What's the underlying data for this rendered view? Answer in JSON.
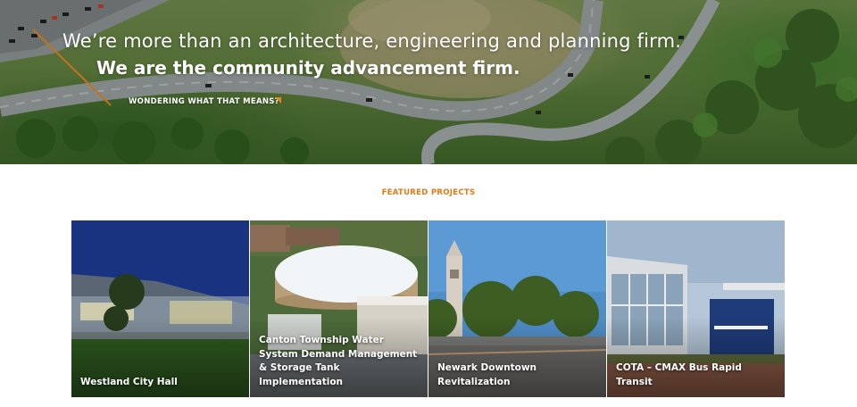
{
  "hero": {
    "line1": "We’re more than an architecture, engineering and planning firm.",
    "line2": "We are the community advancement firm.",
    "link_label": "WONDERING WHAT THAT MEANS?"
  },
  "featured": {
    "heading": "FEATURED PROJECTS",
    "projects": [
      {
        "title": "Westland City Hall"
      },
      {
        "title": "Canton Township Water System Demand Management & Storage Tank Implementation"
      },
      {
        "title": "Newark Downtown Revitalization"
      },
      {
        "title": "COTA – CMAX Bus Rapid Transit"
      }
    ]
  },
  "colors": {
    "accent": "#e07b16",
    "text_on_image": "#ffffff"
  },
  "icons": {
    "hero_link": "corner-arrow-icon"
  }
}
